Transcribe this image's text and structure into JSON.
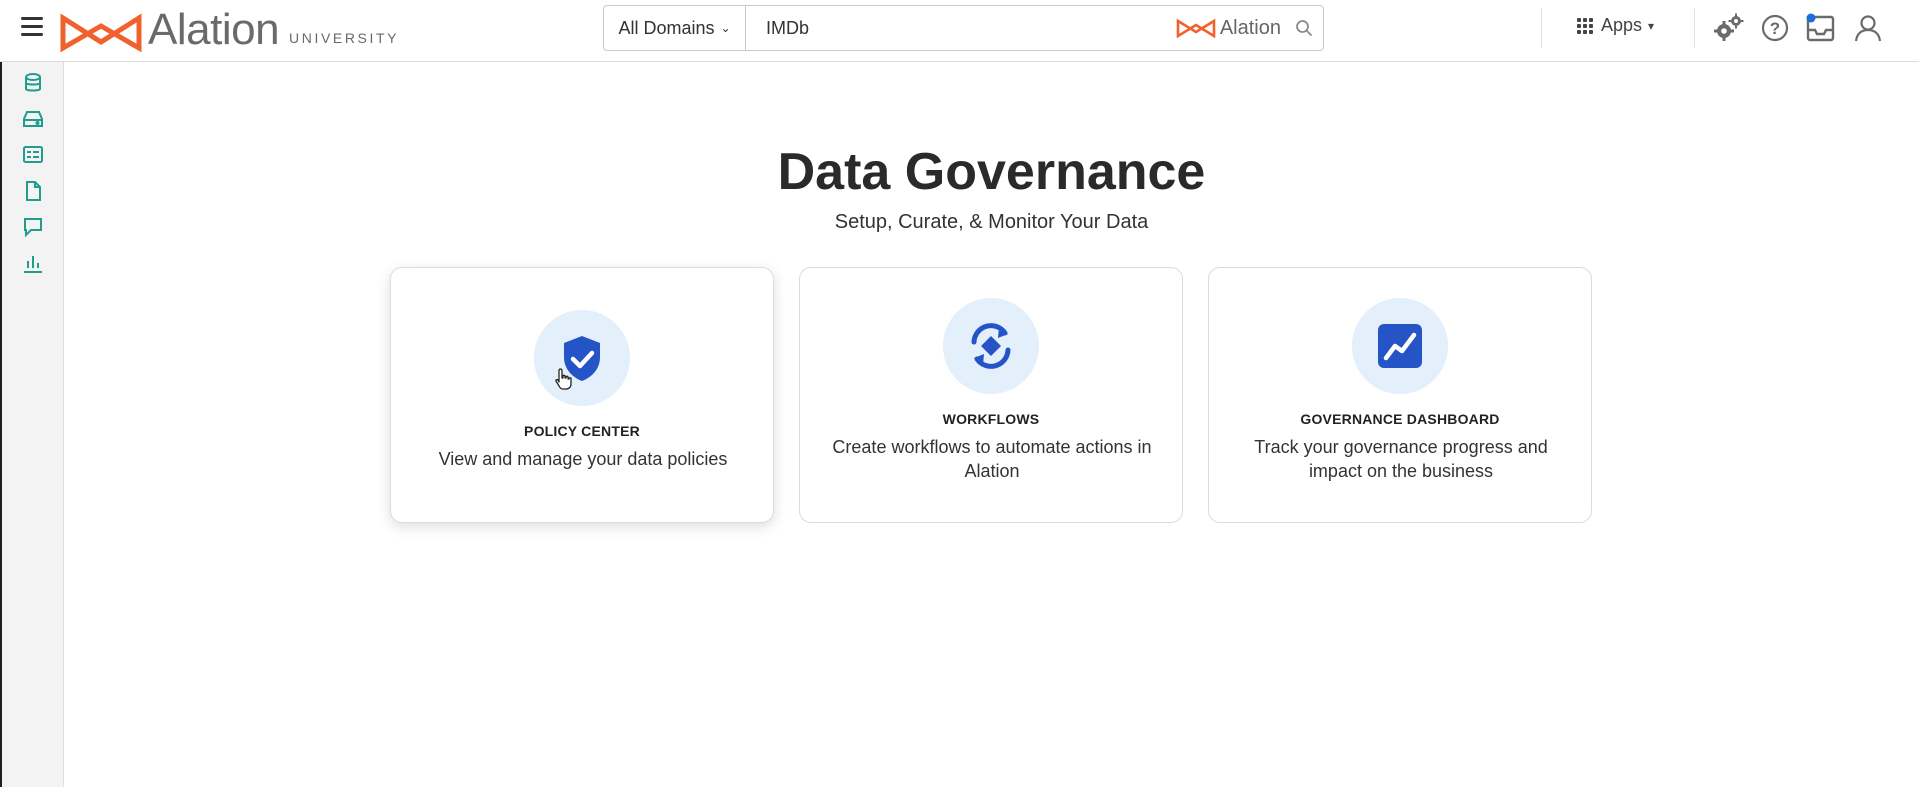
{
  "app": {
    "logo_text": "Alation",
    "logo_subtitle": "UNIVERSITY",
    "brand_color": "#f0612e",
    "accent_color": "#1f9e8d"
  },
  "search": {
    "domain_label": "All Domains",
    "value": "IMDb",
    "brand_text": "Alation"
  },
  "header": {
    "apps_label": "Apps",
    "icons": [
      "settings-gears-icon",
      "help-icon",
      "inbox-icon",
      "user-profile-icon"
    ]
  },
  "sidebar": {
    "icons": [
      "database-icon",
      "data-source-icon",
      "catalog-card-icon",
      "document-icon",
      "conversation-icon",
      "analytics-chart-icon"
    ]
  },
  "main": {
    "title": "Data Governance",
    "subtitle": "Setup, Curate, & Monitor Your Data",
    "cards": [
      {
        "title": "POLICY CENTER",
        "description": "View and manage your data policies",
        "icon": "shield-check-icon"
      },
      {
        "title": "WORKFLOWS",
        "description": "Create workflows to automate actions in Alation",
        "icon": "workflow-sync-icon"
      },
      {
        "title": "GOVERNANCE DASHBOARD",
        "description": "Track your governance progress and impact on the business",
        "icon": "trend-chart-icon"
      }
    ]
  }
}
